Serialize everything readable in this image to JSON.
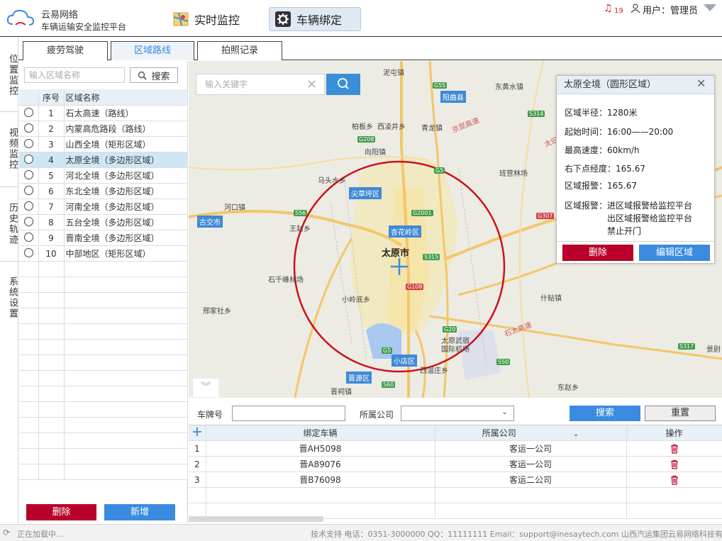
{
  "header": {
    "brand_name": "云易网络",
    "brand_sub": "车辆运输安全监控平台",
    "nav": [
      {
        "label": "实时监控"
      },
      {
        "label": "车辆绑定"
      }
    ],
    "alert_count": "19",
    "user_label": "用户：管理员"
  },
  "leftnav": [
    {
      "label": "位置监控"
    },
    {
      "label": "视频监控"
    },
    {
      "label": "历史轨迹"
    },
    {
      "label": "系统设置"
    }
  ],
  "subtabs": [
    {
      "label": "疲劳驾驶"
    },
    {
      "label": "区域路线"
    },
    {
      "label": "拍照记录"
    }
  ],
  "region_list": {
    "search_placeholder": "输入区域名称",
    "search_label": "搜索",
    "col_index": "序号",
    "col_name": "区域名称",
    "rows": [
      {
        "index": "1",
        "name": "石太高速（路线）"
      },
      {
        "index": "2",
        "name": "内蒙高危路段（路线）"
      },
      {
        "index": "3",
        "name": "山西全境（矩形区域）"
      },
      {
        "index": "4",
        "name": "太原全境（多边形区域）"
      },
      {
        "index": "5",
        "name": "河北全境（多边形区域）"
      },
      {
        "index": "6",
        "name": "东北全境（多边形区域）"
      },
      {
        "index": "7",
        "name": "河南全境（多边形区域）"
      },
      {
        "index": "8",
        "name": "五台全境（多边形区域）"
      },
      {
        "index": "9",
        "name": "晋南全境（多边形区域）"
      },
      {
        "index": "10",
        "name": "中部地区（矩形区域）"
      }
    ],
    "selected_index": 3,
    "delete_label": "删除",
    "add_label": "新增"
  },
  "map": {
    "search_placeholder": "输入关键字",
    "labels": {
      "nihe": "泥屯镇",
      "dongbei": "东黄水镇",
      "yangqu": "阳曲县",
      "baiyi": "柏板乡",
      "xilu": "西凌井乡",
      "qingshui": "青龙镇",
      "xiangyang": "向阳镇",
      "banchi": "班营林场",
      "maqu": "马头水乡",
      "hekou": "河口镇",
      "jiancao": "尖草坪区",
      "wangfeng": "王封乡",
      "gujiao": "古交市",
      "xinghualing": "杏花岭区",
      "taiyuan": "太原市",
      "shiqian": "石千峰林场",
      "xiaobei": "小岭底乡",
      "shijiao": "什贴镇",
      "xiaodian": "小店区",
      "jinyuan": "晋源区",
      "airport": "太原武宿国际机场",
      "xishan": "西温庄乡",
      "dongzhao": "东赵乡",
      "qingxu": "晋祠镇",
      "jingzhuang": "景尉",
      "xingjia": "邢家社乡",
      "s1": "G55",
      "s2": "G5",
      "s3": "S314",
      "s4": "G208",
      "s5": "G307",
      "s6": "G2001",
      "s7": "S56",
      "s8": "S315",
      "s9": "G108",
      "s10": "G20",
      "s11": "S50",
      "s12": "S317",
      "s13": "S60",
      "s14": "G5"
    },
    "expressway_labels": [
      "京昆高速",
      "太旧高速",
      "石太高速"
    ]
  },
  "popup": {
    "title": "太原全境（圆形区域）",
    "radius_label": "区域半径：",
    "radius_value": "1280米",
    "time_label": "起始时间：",
    "time_value": "16:00——20:00",
    "speed_label": "最高速度：",
    "speed_value": "60km/h",
    "coord_label": "右下点经度：",
    "coord_value": "165.67",
    "alarm_label": "区域报警：",
    "alarm_value": "165.67",
    "alarm2_label": "区域报警：",
    "alarm2_lines": [
      "进区域报警给监控平台",
      "出区域报警给监控平台",
      "禁止开门"
    ],
    "delete_label": "删除",
    "edit_label": "编辑区域"
  },
  "filter": {
    "plate_label": "车牌号",
    "company_label": "所属公司",
    "search_label": "搜索",
    "reset_label": "重置"
  },
  "binding_table": {
    "col_vehicle": "绑定车辆",
    "col_company": "所属公司",
    "col_action": "操作",
    "rows": [
      {
        "index": "1",
        "vehicle": "晋AH5098",
        "company": "客运一公司"
      },
      {
        "index": "2",
        "vehicle": "晋A89076",
        "company": "客运一公司"
      },
      {
        "index": "3",
        "vehicle": "晋B76098",
        "company": "客运二公司"
      }
    ]
  },
  "footer": {
    "loading": "正在加载中...",
    "support": "技术支持 电话：0351-3000000 QQ：11111111 Email：support@inesaytech.com 山西汽运集团云易网络科技有限公司"
  },
  "colors": {
    "accent_blue": "#3a8be0",
    "danger_red": "#b8002a",
    "circle_red": "#d0101a",
    "selected_row": "#cfe6f5"
  }
}
